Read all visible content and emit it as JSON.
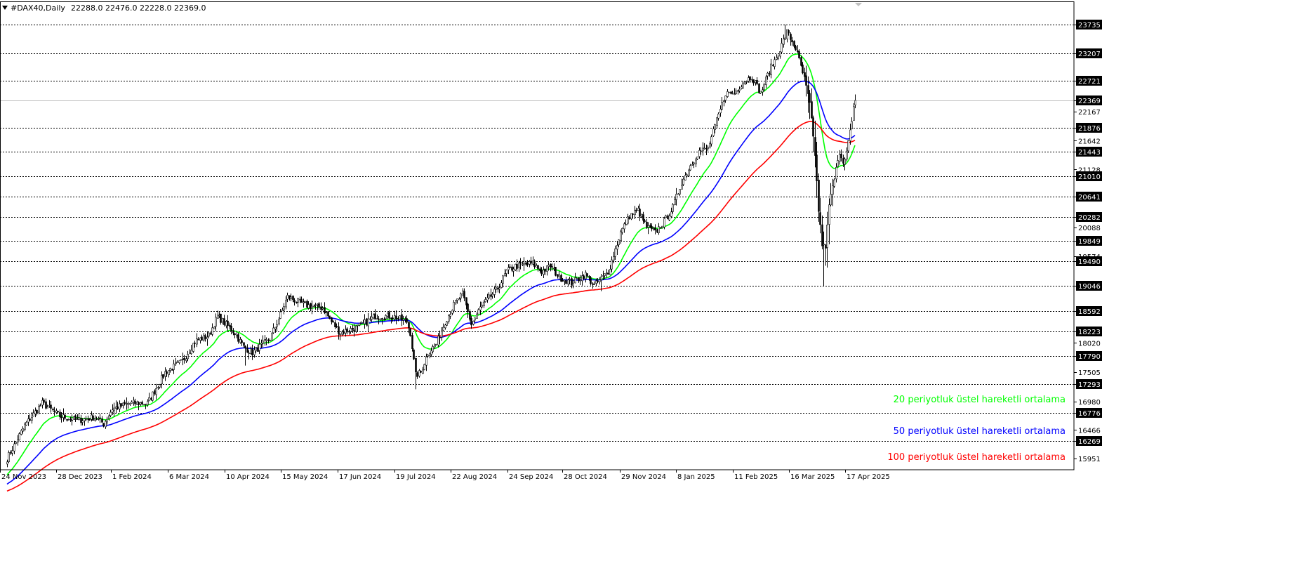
{
  "header": {
    "symbol": "#DAX40,Daily",
    "ohlc": "22288.0 22476.0 22228.0 22369.0"
  },
  "colors": {
    "background": "#ffffff",
    "candle": "#000000",
    "grid": "#000000",
    "ema20": "#00ff00",
    "ema50": "#0000ff",
    "ema100": "#ff0000",
    "price_label_bg": "#000000",
    "price_label_text": "#ffffff"
  },
  "chart_data": {
    "type": "candlestick",
    "title": "#DAX40,Daily",
    "ylim": [
      15800,
      23900
    ],
    "y_tick_labels": [
      "23735",
      "23207",
      "22721",
      "22369",
      "22167",
      "21876",
      "21642",
      "21443",
      "21128",
      "21010",
      "20641",
      "20282",
      "20088",
      "19849",
      "19574",
      "19490",
      "19046",
      "18592",
      "18223",
      "18020",
      "17790",
      "17505",
      "17293",
      "16980",
      "16776",
      "16466",
      "16269",
      "15951"
    ],
    "boxed_levels": [
      23735,
      23207,
      22721,
      22369,
      21876,
      21443,
      21010,
      20641,
      20282,
      19849,
      19490,
      19046,
      18592,
      18223,
      17790,
      17293,
      16776,
      16269
    ],
    "current_price": 22369,
    "x_tick_labels": [
      "24 Nov 2023",
      "28 Dec 2023",
      "1 Feb 2024",
      "6 Mar 2024",
      "10 Apr 2024",
      "15 May 2024",
      "17 Jun 2024",
      "19 Jul 2024",
      "22 Aug 2024",
      "24 Sep 2024",
      "28 Oct 2024",
      "29 Nov 2024",
      "8 Jan 2025",
      "11 Feb 2025",
      "16 Mar 2025",
      "17 Apr 2025"
    ],
    "series": [
      {
        "name": "20 periyotluk üstel hareketli ortalama",
        "color": "#00ff00",
        "period": 20
      },
      {
        "name": "50 periyotluk üstel hareketli ortalama",
        "color": "#0000ff",
        "period": 50
      },
      {
        "name": "100 periyotluk üstel hareketli ortalama",
        "color": "#ff0000",
        "period": 100
      }
    ],
    "close_path": [
      [
        0,
        15950
      ],
      [
        10,
        16550
      ],
      [
        20,
        16950
      ],
      [
        30,
        16720
      ],
      [
        40,
        16640
      ],
      [
        50,
        16700
      ],
      [
        55,
        16580
      ],
      [
        60,
        16850
      ],
      [
        70,
        16950
      ],
      [
        80,
        16950
      ],
      [
        90,
        17500
      ],
      [
        100,
        17700
      ],
      [
        107,
        18050
      ],
      [
        115,
        18150
      ],
      [
        120,
        18500
      ],
      [
        130,
        18200
      ],
      [
        135,
        17950
      ],
      [
        140,
        17850
      ],
      [
        150,
        18100
      ],
      [
        155,
        18450
      ],
      [
        160,
        18850
      ],
      [
        170,
        18700
      ],
      [
        180,
        18650
      ],
      [
        185,
        18400
      ],
      [
        190,
        18200
      ],
      [
        200,
        18300
      ],
      [
        210,
        18500
      ],
      [
        220,
        18500
      ],
      [
        228,
        18400
      ],
      [
        230,
        18200
      ],
      [
        233,
        17450
      ],
      [
        236,
        17500
      ],
      [
        240,
        17850
      ],
      [
        245,
        18000
      ],
      [
        250,
        18400
      ],
      [
        255,
        18700
      ],
      [
        260,
        18900
      ],
      [
        265,
        18350
      ],
      [
        270,
        18650
      ],
      [
        280,
        19000
      ],
      [
        285,
        19300
      ],
      [
        290,
        19400
      ],
      [
        300,
        19450
      ],
      [
        305,
        19300
      ],
      [
        310,
        19400
      ],
      [
        315,
        19200
      ],
      [
        322,
        19100
      ],
      [
        330,
        19250
      ],
      [
        335,
        19050
      ],
      [
        343,
        19300
      ],
      [
        350,
        20000
      ],
      [
        355,
        20300
      ],
      [
        360,
        20400
      ],
      [
        365,
        20100
      ],
      [
        370,
        20000
      ],
      [
        375,
        20200
      ],
      [
        380,
        20450
      ],
      [
        385,
        20900
      ],
      [
        390,
        21200
      ],
      [
        395,
        21450
      ],
      [
        400,
        21500
      ],
      [
        405,
        22000
      ],
      [
        410,
        22500
      ],
      [
        415,
        22500
      ],
      [
        420,
        22700
      ],
      [
        425,
        22800
      ],
      [
        430,
        22500
      ],
      [
        435,
        22900
      ],
      [
        440,
        23200
      ],
      [
        445,
        23600
      ],
      [
        450,
        23300
      ],
      [
        455,
        22750
      ],
      [
        458,
        22300
      ],
      [
        461,
        21400
      ],
      [
        463,
        20400
      ],
      [
        465,
        19800
      ],
      [
        467,
        19700
      ],
      [
        469,
        20500
      ],
      [
        471,
        20800
      ],
      [
        473,
        21200
      ],
      [
        475,
        21450
      ],
      [
        477,
        21200
      ],
      [
        479,
        21400
      ],
      [
        481,
        21800
      ],
      [
        483,
        22250
      ],
      [
        484,
        22369
      ]
    ]
  },
  "legend": {
    "ema20": "20 periyotluk üstel hareketli ortalama",
    "ema50": "50 periyotluk üstel hareketli ortalama",
    "ema100": "100 periyotluk üstel hareketli ortalama"
  }
}
